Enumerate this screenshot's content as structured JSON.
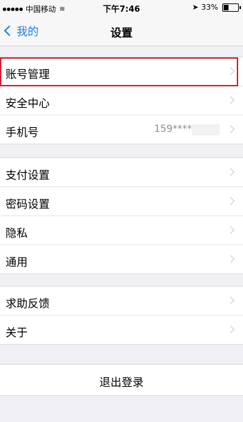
{
  "status": {
    "carrier": "中国移动",
    "time": "下午7:46",
    "battery_text": "33%",
    "battery_level": 0.33
  },
  "nav": {
    "back_label": "我的",
    "title": "设置"
  },
  "groups": [
    {
      "items": [
        {
          "label": "账号管理"
        },
        {
          "label": "安全中心"
        },
        {
          "label": "手机号",
          "value": "159****"
        }
      ]
    },
    {
      "items": [
        {
          "label": "支付设置"
        },
        {
          "label": "密码设置"
        },
        {
          "label": "隐私"
        },
        {
          "label": "通用"
        }
      ]
    },
    {
      "items": [
        {
          "label": "求助反馈"
        },
        {
          "label": "关于"
        }
      ]
    }
  ],
  "logout_label": "退出登录",
  "colors": {
    "accent": "#1a7cf2",
    "highlight": "#d0212f",
    "background": "#efeff4"
  }
}
